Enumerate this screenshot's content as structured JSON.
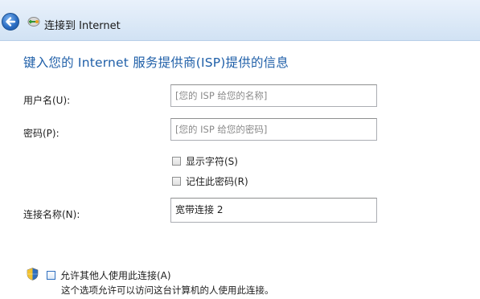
{
  "window": {
    "title": "连接到 Internet"
  },
  "heading": "键入您的 Internet 服务提供商(ISP)提供的信息",
  "form": {
    "username": {
      "label": "用户名(U):",
      "placeholder": "[您的 ISP 给您的名称]",
      "value": ""
    },
    "password": {
      "label": "密码(P):",
      "placeholder": "[您的 ISP 给您的密码]",
      "value": ""
    },
    "show_characters": {
      "label": "显示字符(S)",
      "checked": false
    },
    "remember_password": {
      "label": "记住此密码(R)",
      "checked": false
    },
    "connection_name": {
      "label": "连接名称(N):",
      "value": "宽带连接 2"
    },
    "allow_others": {
      "label": "允许其他人使用此连接(A)",
      "checked": false,
      "description": "这个选项允许可以访问这台计算机的人使用此连接。"
    }
  },
  "icons": {
    "back": "back-arrow-icon",
    "network": "network-connection-icon",
    "shield": "uac-shield-icon"
  },
  "colors": {
    "heading": "#1f5fa8",
    "titlebar": "#dce9f7",
    "back_button": "#2d6fc4"
  }
}
